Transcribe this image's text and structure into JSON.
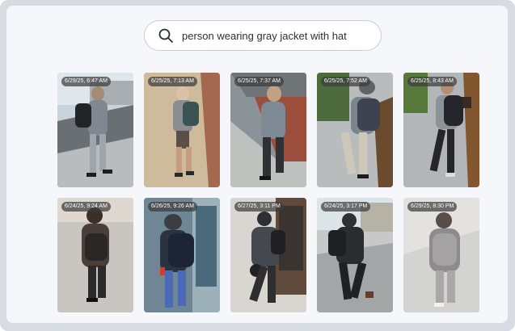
{
  "search": {
    "icon": "search-icon",
    "query": "person wearing gray jacket with hat"
  },
  "results": [
    {
      "timestamp": "6/29/25, 6:47 AM",
      "scene": "street"
    },
    {
      "timestamp": "6/25/25, 7:13 AM",
      "scene": "sidewalk-tan"
    },
    {
      "timestamp": "6/25/25, 7:37 AM",
      "scene": "brick-walk"
    },
    {
      "timestamp": "6/25/25, 7:52 AM",
      "scene": "hedge-walk"
    },
    {
      "timestamp": "6/25/25, 8:43 AM",
      "scene": "fence-walk"
    },
    {
      "timestamp": "6/24/25, 9:24 AM",
      "scene": "plaza"
    },
    {
      "timestamp": "6/26/25, 9:26 AM",
      "scene": "storefront"
    },
    {
      "timestamp": "6/27/25, 3:11 PM",
      "scene": "doorway"
    },
    {
      "timestamp": "6/24/25, 3:17 PM",
      "scene": "street-house"
    },
    {
      "timestamp": "6/29/25, 8:30 PM",
      "scene": "plaza-light"
    }
  ],
  "colors": {
    "frame": "#d7dbe2",
    "panel": "#f6f7fb",
    "badge": "#3c3c3c"
  }
}
